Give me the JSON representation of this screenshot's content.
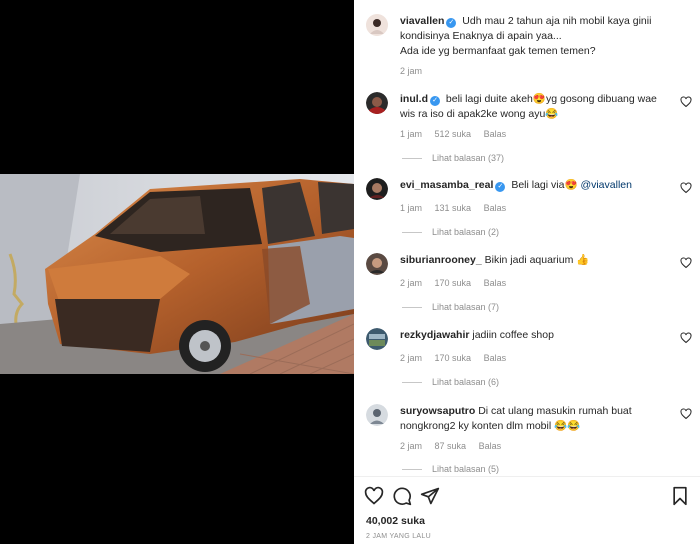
{
  "post": {
    "author": "viavallen",
    "caption_line1": "Udh mau 2 tahun aja nih mobil kaya ginii kondisinya Enaknya di apain yaa...",
    "caption_line2": "Ada ide yg bermanfaat gak temen temen?",
    "time": "2 jam",
    "likes": "40,002 suka",
    "posted": "2 JAM YANG LALU"
  },
  "comments": [
    {
      "user": "inul.d",
      "verified": true,
      "text": "beli lagi duite akeh😍yg gosong dibuang wae wis ra iso di apak2ke wong ayu😂",
      "time": "1 jam",
      "likes": "512 suka",
      "reply": "Balas",
      "view_replies": "Lihat balasan (37)"
    },
    {
      "user": "evi_masamba_real",
      "verified": true,
      "text": "Beli lagi via😍",
      "mention": "@viavallen",
      "time": "1 jam",
      "likes": "131 suka",
      "reply": "Balas",
      "view_replies": "Lihat balasan (2)"
    },
    {
      "user": "siburianrooney_",
      "verified": false,
      "text": "Bikin jadi aquarium 👍",
      "time": "2 jam",
      "likes": "170 suka",
      "reply": "Balas",
      "view_replies": "Lihat balasan (7)"
    },
    {
      "user": "rezkydjawahir",
      "verified": false,
      "text": "jadiin coffee shop",
      "time": "2 jam",
      "likes": "170 suka",
      "reply": "Balas",
      "view_replies": "Lihat balasan (6)"
    },
    {
      "user": "suryowsaputro",
      "verified": false,
      "text": "Di cat ulang masukin rumah buat nongkrong2 ky konten dlm mobil 😂😂",
      "time": "2 jam",
      "likes": "87 suka",
      "reply": "Balas",
      "view_replies": "Lihat balasan (5)"
    }
  ],
  "icons": {
    "like": "heart-icon",
    "comment": "comment-icon",
    "share": "send-icon",
    "save": "bookmark-icon",
    "verified": "verified-badge-icon"
  },
  "colors": {
    "verified": "#3897f0",
    "meta": "#8e8e8e",
    "text": "#262626"
  }
}
